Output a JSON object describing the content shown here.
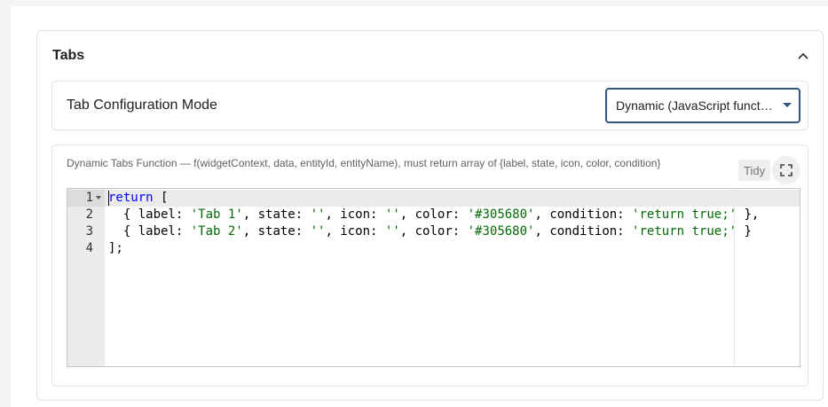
{
  "panel": {
    "title": "Tabs",
    "collapse_icon": "chevron-up-icon"
  },
  "mode": {
    "label": "Tab Configuration Mode",
    "selected": "Dynamic (JavaScript funct…",
    "accent_color": "#305680"
  },
  "function_editor": {
    "label": "Dynamic Tabs Function — f(widgetContext, data, entityId, entityName), must return array of {label, state, icon, color, condition}",
    "tidy_label": "Tidy",
    "fullscreen_icon": "fullscreen-icon",
    "line_numbers": [
      "1",
      "2",
      "3",
      "4"
    ],
    "code": {
      "line1_kw": "return",
      "line1_rest": " [",
      "line2_a": "  { label: ",
      "line2_s1": "'Tab 1'",
      "line2_b": ", state: ",
      "line2_s2": "''",
      "line2_c": ", icon: ",
      "line2_s3": "''",
      "line2_d": ", color: ",
      "line2_s4": "'#305680'",
      "line2_e": ", condition: ",
      "line2_s5": "'return true;'",
      "line2_f": " },",
      "line3_a": "  { label: ",
      "line3_s1": "'Tab 2'",
      "line3_b": ", state: ",
      "line3_s2": "''",
      "line3_c": ", icon: ",
      "line3_s3": "''",
      "line3_d": ", color: ",
      "line3_s4": "'#305680'",
      "line3_e": ", condition: ",
      "line3_s5": "'return true;'",
      "line3_f": " }",
      "line4": "];"
    }
  }
}
